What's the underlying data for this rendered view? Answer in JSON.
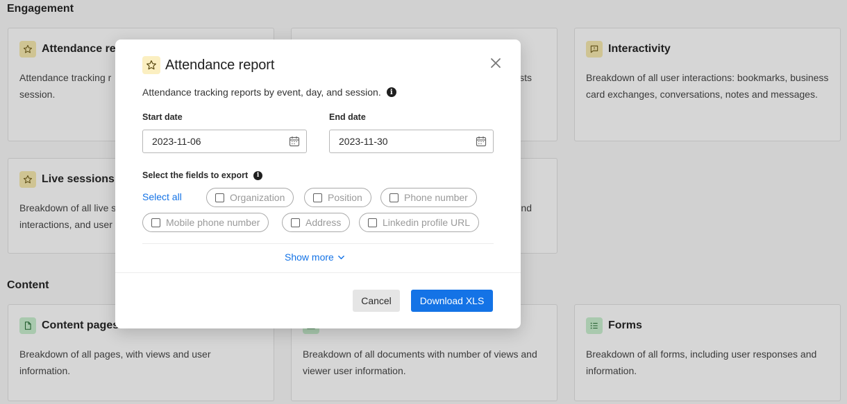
{
  "sections": {
    "engagement": "Engagement",
    "content": "Content"
  },
  "cards": {
    "attendance": {
      "title": "Attendance re",
      "desc": "Attendance tracking r\nsession."
    },
    "middle_top": {
      "desc": "sts"
    },
    "interactivity": {
      "title": "Interactivity",
      "desc": "Breakdown of all user interactions: bookmarks, business card exchanges, conversations, notes and messages."
    },
    "live_sessions": {
      "title": "Live sessions",
      "desc": "Breakdown of all live s\ninteractions, and user"
    },
    "middle_mid": {
      "desc": "nd"
    },
    "content_pages": {
      "title": "Content pages",
      "desc": "Breakdown of all pages, with views and user information."
    },
    "documents": {
      "desc": "Breakdown of all documents with number of views and viewer user information."
    },
    "forms": {
      "title": "Forms",
      "desc": "Breakdown of all forms, including user responses and information."
    }
  },
  "modal": {
    "title": "Attendance report",
    "icon": "star-icon",
    "description": "Attendance tracking reports by event, day, and session.",
    "start_date_label": "Start date",
    "start_date_value": "2023-11-06",
    "end_date_label": "End date",
    "end_date_value": "2023-11-30",
    "fields_label": "Select the fields to export",
    "select_all": "Select all",
    "fields": [
      "Organization",
      "Position",
      "Phone number",
      "Mobile phone number",
      "Address",
      "Linkedin profile URL"
    ],
    "show_more": "Show more",
    "cancel": "Cancel",
    "download": "Download XLS"
  },
  "colors": {
    "accent": "#1473e6",
    "icon_yellow": "#fbefc1",
    "icon_green": "#a9c9ae"
  }
}
